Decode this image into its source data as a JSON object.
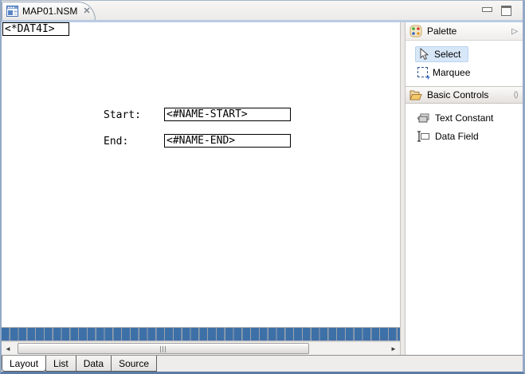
{
  "window": {
    "tab_title": "MAP01.NSM",
    "close_glyph": "✕"
  },
  "canvas": {
    "date_literal": "<*DAT4I>",
    "fields": [
      {
        "label": "Start:",
        "value": "<#NAME-START>"
      },
      {
        "label": "End:",
        "value": "<#NAME-END>"
      }
    ]
  },
  "palette": {
    "title": "Palette",
    "collapse_glyph": "▷",
    "tools": [
      {
        "label": "Select",
        "selected": true
      },
      {
        "label": "Marquee",
        "selected": false
      }
    ],
    "drawer": {
      "title": "Basic Controls",
      "pin_glyph": "⟨⟩",
      "items": [
        {
          "label": "Text Constant"
        },
        {
          "label": "Data Field"
        }
      ]
    }
  },
  "bottom_tabs": [
    {
      "label": "Layout",
      "active": true
    },
    {
      "label": "List",
      "active": false
    },
    {
      "label": "Data",
      "active": false
    },
    {
      "label": "Source",
      "active": false
    }
  ],
  "scrollbar": {
    "left_glyph": "◄",
    "right_glyph": "►"
  },
  "colors": {
    "selection_highlight": "#d7e7f8",
    "stripe_blue": "#3e70a8",
    "frame_blue": "#93a9c5",
    "tab_underline": "#b9cce3"
  }
}
